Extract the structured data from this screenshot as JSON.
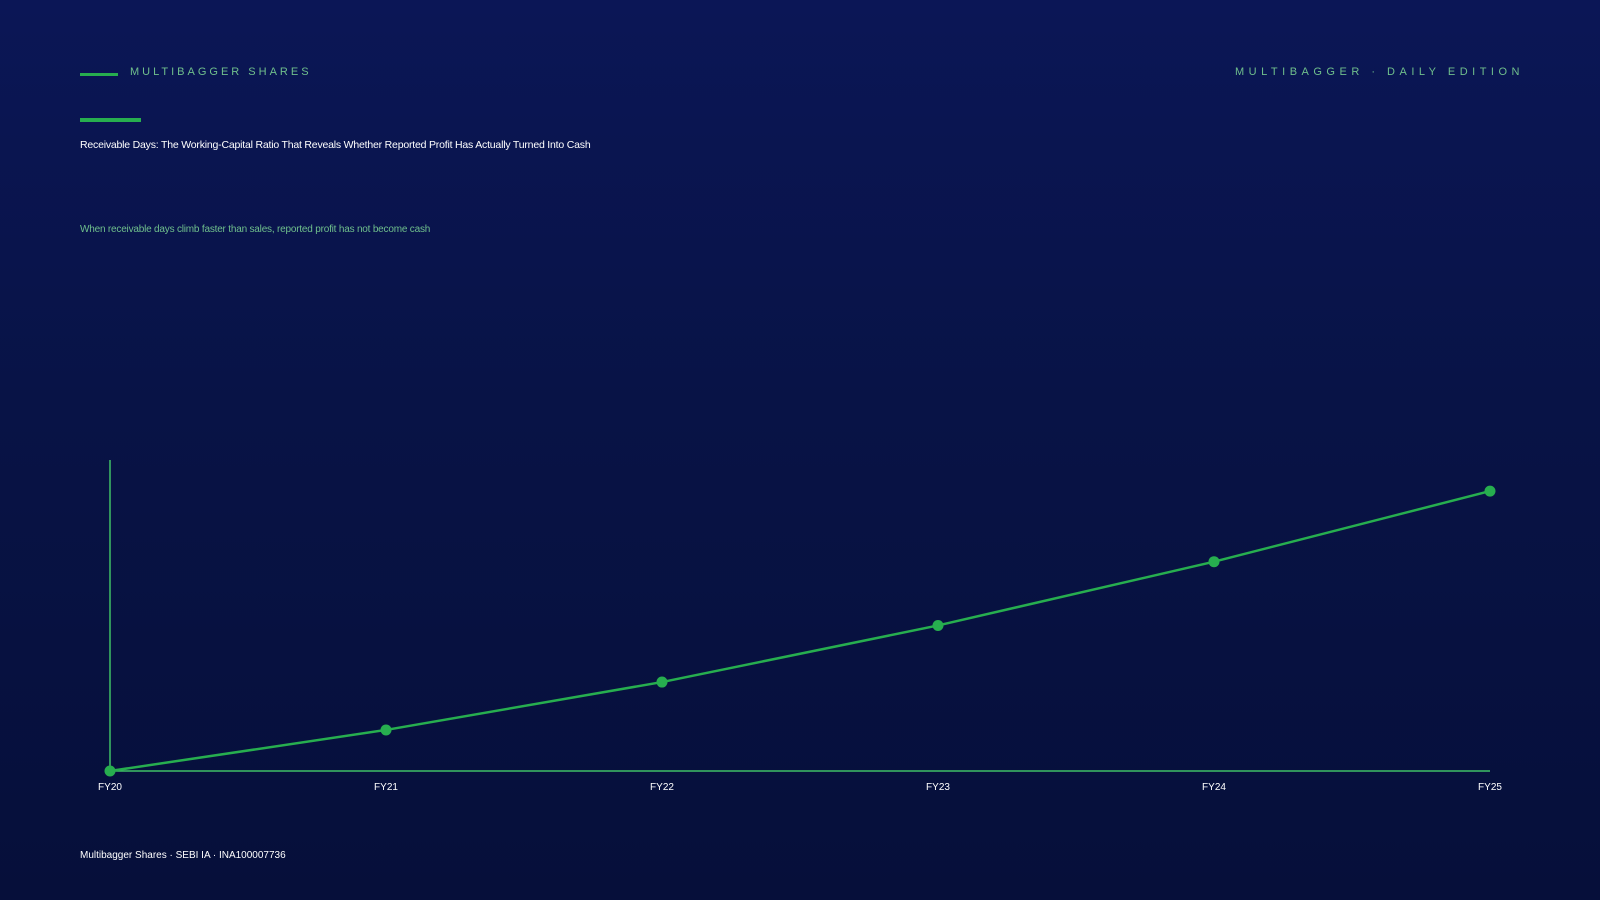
{
  "header": {
    "brand": "MULTIBAGGER SHARES",
    "edition": "MULTIBAGGER · DAILY EDITION"
  },
  "title": "Receivable Days: The Working-Capital Ratio That Reveals Whether Reported Profit Has Actually Turned Into Cash",
  "subtitle": "When receivable days climb faster than sales, reported profit has not become cash",
  "footer": "Multibagger Shares · SEBI IA · INA100007736",
  "colors": {
    "accent": "#27ae4f",
    "muted_text": "#6fbf8c",
    "background": "#081346"
  },
  "chart_data": {
    "type": "line",
    "categories": [
      "FY20",
      "FY21",
      "FY22",
      "FY23",
      "FY24",
      "FY25"
    ],
    "values": [
      0,
      13.2,
      28.6,
      46.8,
      67.3,
      90
    ],
    "ylim": [
      0,
      100
    ],
    "grid": false,
    "title": "",
    "xlabel": "",
    "ylabel": ""
  }
}
